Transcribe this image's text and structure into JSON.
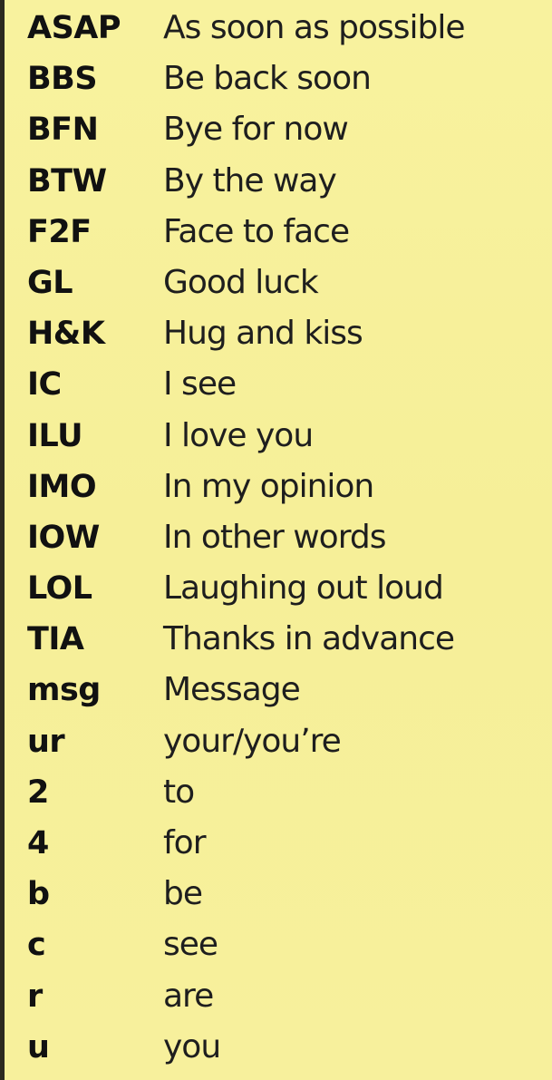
{
  "abbreviations": [
    {
      "abbr": "ASAP",
      "meaning": "As soon as possible"
    },
    {
      "abbr": "BBS",
      "meaning": "Be back soon"
    },
    {
      "abbr": "BFN",
      "meaning": "Bye for now"
    },
    {
      "abbr": "BTW",
      "meaning": "By the way"
    },
    {
      "abbr": "F2F",
      "meaning": "Face to face"
    },
    {
      "abbr": "GL",
      "meaning": "Good luck"
    },
    {
      "abbr": "H&K",
      "meaning": "Hug and kiss"
    },
    {
      "abbr": "IC",
      "meaning": "I see"
    },
    {
      "abbr": "ILU",
      "meaning": "I love you"
    },
    {
      "abbr": "IMO",
      "meaning": "In my opinion"
    },
    {
      "abbr": "IOW",
      "meaning": "In other words"
    },
    {
      "abbr": "LOL",
      "meaning": "Laughing out loud"
    },
    {
      "abbr": "TIA",
      "meaning": "Thanks in advance"
    },
    {
      "abbr": "msg",
      "meaning": "Message"
    },
    {
      "abbr": "ur",
      "meaning": "your/you’re"
    },
    {
      "abbr": "2",
      "meaning": "to"
    },
    {
      "abbr": "4",
      "meaning": "for"
    },
    {
      "abbr": "b",
      "meaning": "be"
    },
    {
      "abbr": "c",
      "meaning": "see"
    },
    {
      "abbr": "r",
      "meaning": "are"
    },
    {
      "abbr": "u",
      "meaning": "you"
    }
  ],
  "colors": {
    "background": "#f7f09a",
    "text": "#111111",
    "edge": "#2c2a1f"
  }
}
